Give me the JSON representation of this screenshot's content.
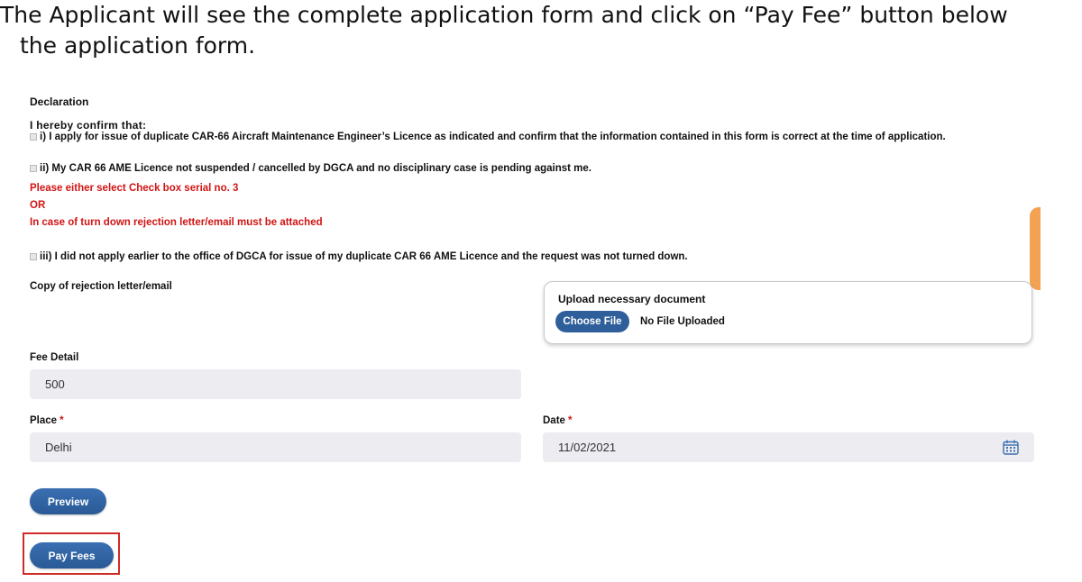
{
  "caption": {
    "line1": "The Applicant will see the complete application form and click on “Pay Fee” button below",
    "line2": "the application form."
  },
  "declaration": {
    "title": "Declaration",
    "confirm_heading": "I hereby confirm that:",
    "item1": "i) I apply for issue of duplicate CAR-66 Aircraft Maintenance Engineer’s Licence as indicated and confirm that the information contained in this form is correct at the time of application.",
    "item2": "ii) My CAR 66 AME Licence not suspended / cancelled by DGCA and no disciplinary case is pending against me.",
    "warn1": "Please either select Check box serial no. 3",
    "warn2": "OR",
    "warn3": "In case of turn down rejection letter/email must be attached",
    "item3": "iii) I did not apply earlier to the office of DGCA for issue of my duplicate CAR 66 AME Licence and the request was not turned down."
  },
  "upload": {
    "copy_label": "Copy of rejection letter/email",
    "box_title": "Upload necessary document",
    "choose_label": "Choose File",
    "status": "No File Uploaded"
  },
  "fee": {
    "label": "Fee Detail",
    "value": "500"
  },
  "place": {
    "label": "Place",
    "required_mark": "*",
    "value": "Delhi"
  },
  "date": {
    "label": "Date",
    "required_mark": "*",
    "value": "11/02/2021"
  },
  "buttons": {
    "preview": "Preview",
    "pay_fees": "Pay Fees"
  },
  "colors": {
    "primary_button": "#2f5f9a",
    "required": "#d11414",
    "highlight": "#cf2b26",
    "side_tab": "#f2a252"
  }
}
